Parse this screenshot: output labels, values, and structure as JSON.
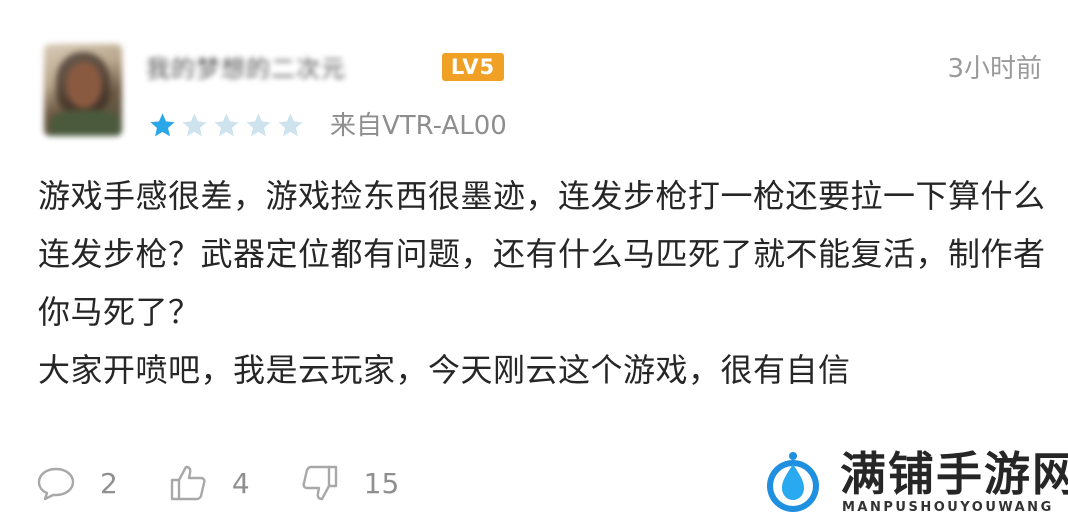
{
  "comment": {
    "username": "我的梦想的二次元",
    "level_badge": "LV5",
    "time": "3小时前",
    "rating": {
      "value": 1,
      "max": 5
    },
    "device": "来自VTR-AL00",
    "paragraphs": [
      "游戏手感很差，游戏捡东西很墨迹，连发步枪打一枪还要拉一下算什么连发步枪？武器定位都有问题，还有什么马匹死了就不能复活，制作者你马死了？",
      "大家开喷吧，我是云玩家，今天刚云这个游戏，很有自信"
    ],
    "actions": {
      "reply_count": "2",
      "like_count": "4",
      "dislike_count": "15"
    }
  },
  "colors": {
    "star_filled": "#2aa7e8",
    "star_empty": "#cfe3ee",
    "level_badge_bg": "#f0a024",
    "meta_text": "#8e8e8e"
  },
  "icons": {
    "reply": "speech-bubble-icon",
    "like": "thumbs-up-icon",
    "dislike": "thumbs-down-icon",
    "star": "star-icon"
  },
  "watermark": {
    "title": "满铺手游网",
    "subtitle": "MANPUSHOUYOUWANG"
  }
}
